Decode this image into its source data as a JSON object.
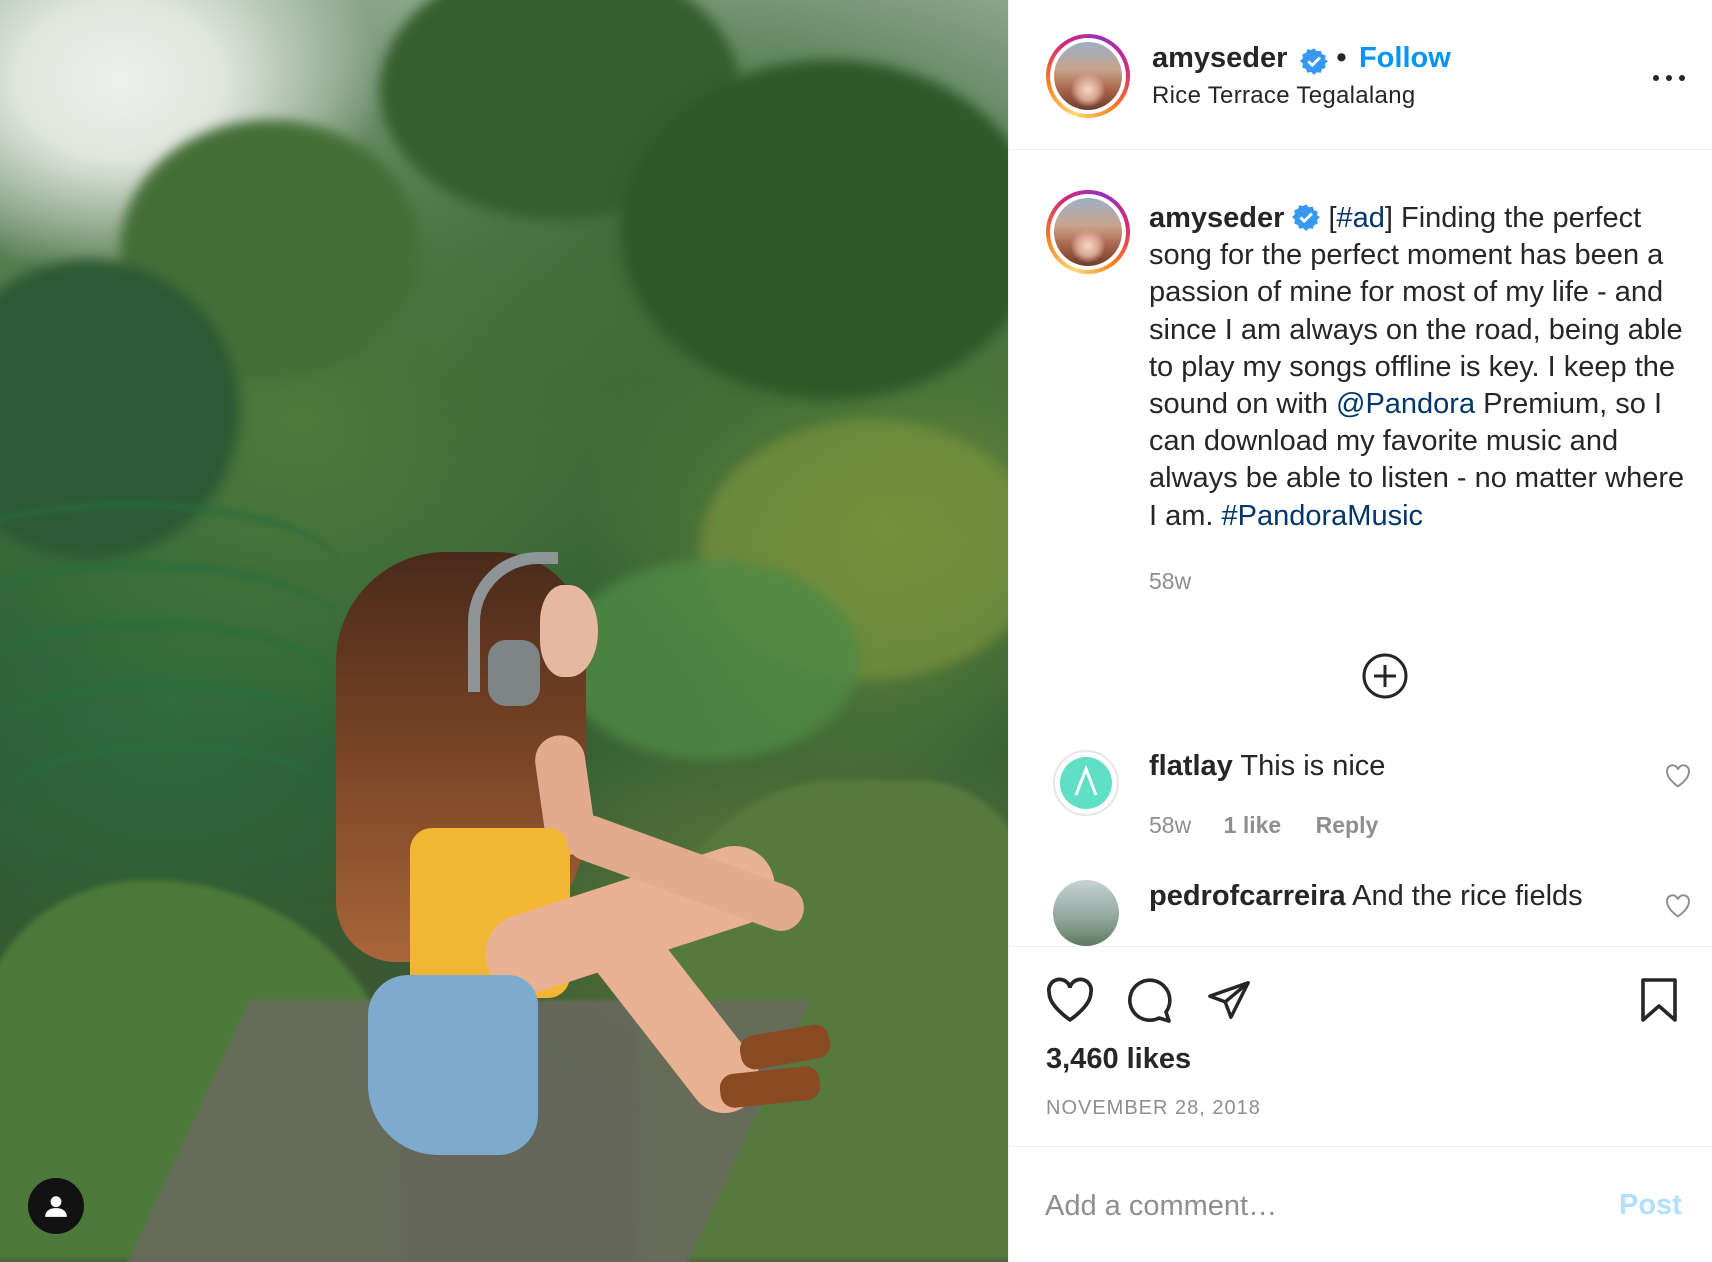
{
  "post": {
    "username": "amyseder",
    "follow_label": "Follow",
    "separator": "•",
    "location": "Rice Terrace Tegalalang"
  },
  "caption": {
    "username": "amyseder",
    "part1": "[",
    "hashtag_ad": "#ad",
    "part2": "] Finding the perfect song for the perfect moment has been a passion of mine for most of my life - and since I am always on the road, being able to play my songs offline is key. I keep the sound on with ",
    "mention": "@Pandora",
    "part3": " Premium, so I can download my favorite music and always be able to listen - no matter where I am. ",
    "hashtag_music": "#PandoraMusic",
    "age": "58w"
  },
  "comments": [
    {
      "username": "flatlay",
      "text": "This is nice",
      "age": "58w",
      "likes": "1 like",
      "reply_label": "Reply"
    },
    {
      "username": "pedrofcarreira",
      "text": "And the rice fields"
    }
  ],
  "stats": {
    "likes": "3,460 likes",
    "date": "NOVEMBER 28, 2018"
  },
  "composer": {
    "placeholder": "Add a comment…",
    "post_label": "Post"
  },
  "icons": {
    "verified": "verified-badge-icon",
    "more": "more-options-icon",
    "add": "load-more-comments-icon",
    "like": "heart-icon",
    "comment": "comment-bubble-icon",
    "share": "paper-plane-icon",
    "save": "bookmark-icon",
    "tag": "user-tag-icon"
  },
  "colors": {
    "accent_blue": "#0095f6",
    "link_dark": "#00376b",
    "muted": "#8e8e8e",
    "post_disabled": "#b2dffc",
    "text": "#262626"
  }
}
